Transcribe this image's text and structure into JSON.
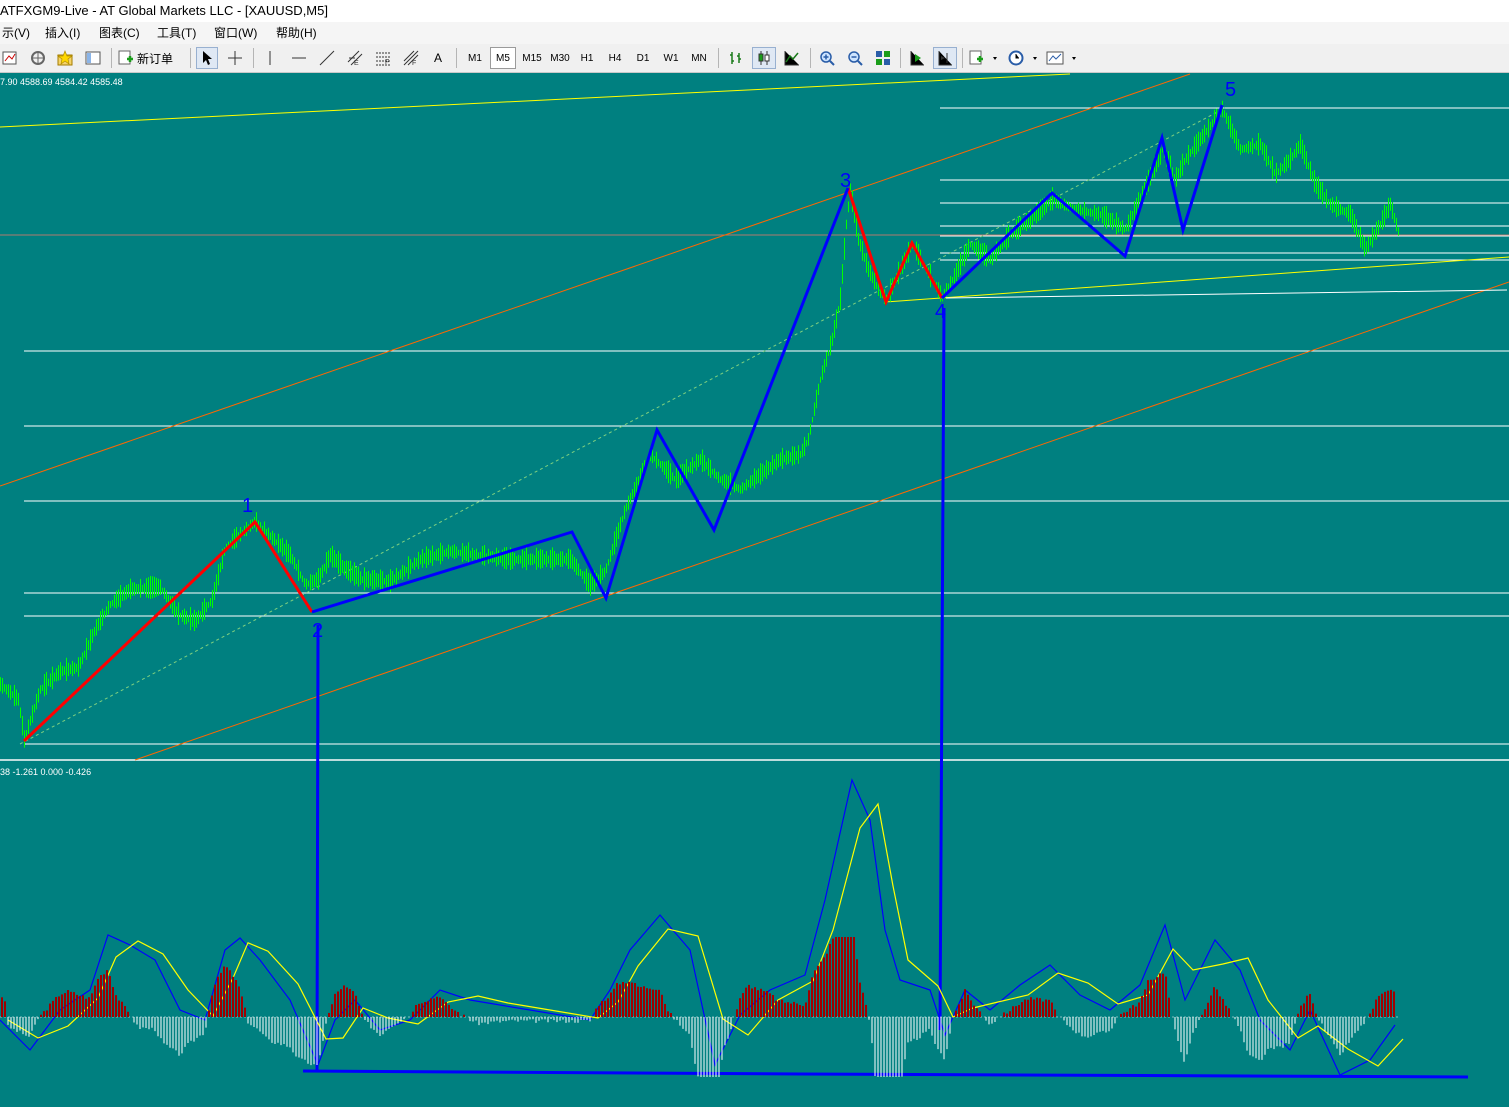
{
  "window": {
    "title": "ATFXGM9-Live - AT Global Markets LLC - [XAUUSD,M5]"
  },
  "menu": [
    {
      "label": "示(V)"
    },
    {
      "label": "插入(I)"
    },
    {
      "label": "图表(C)"
    },
    {
      "label": "工具(T)"
    },
    {
      "label": "窗口(W)"
    },
    {
      "label": "帮助(H)"
    }
  ],
  "toolbar": {
    "new_order_label": "新订单",
    "text_tool_label": "A",
    "timeframes": [
      "M1",
      "M5",
      "M15",
      "M30",
      "H1",
      "H4",
      "D1",
      "W1",
      "MN"
    ],
    "active_timeframe": "M5",
    "icons": [
      "new-chart-icon",
      "profiles-icon",
      "favorites-icon",
      "navigator-icon",
      "new-order-icon",
      "cursor-icon",
      "crosshair-icon",
      "vertical-line-icon",
      "horizontal-line-icon",
      "trendline-icon",
      "equidistant-channel-icon",
      "fibonacci-icon",
      "gann-icon",
      "text-icon",
      "bar-chart-icon",
      "candlestick-icon",
      "line-chart-icon",
      "zoom-in-icon",
      "zoom-out-icon",
      "tile-windows-icon",
      "auto-scroll-icon",
      "chart-shift-icon",
      "indicators-icon",
      "periods-icon",
      "templates-icon"
    ]
  },
  "chart": {
    "symbol": "XAUUSD",
    "period": "M5",
    "price_info": "7.90 4588.69 4584.42 4585.48",
    "macd_info": "38 -1.261 0.000 -0.426",
    "wave_labels": [
      "1",
      "2",
      "3",
      "4",
      "5"
    ],
    "colors": {
      "background": "#008080",
      "candles": "#00ff00",
      "wave_up": "#0000ff",
      "wave_correction": "#ff0000",
      "channel": "#ff6600",
      "support": "#ffff00",
      "levels": "#ffffff",
      "macd_main": "#0000ff",
      "macd_signal": "#ffff00",
      "hist_positive": "#a00000",
      "hist_negative": "#ffffff"
    }
  }
}
